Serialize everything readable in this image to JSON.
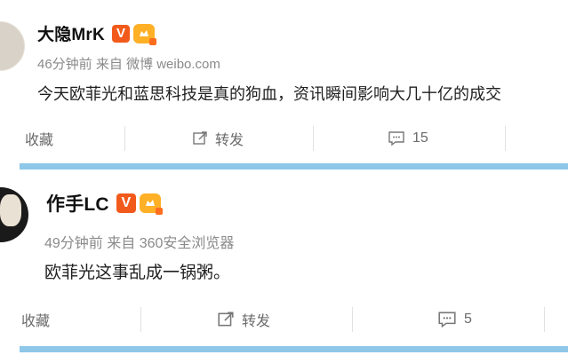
{
  "posts": [
    {
      "username": "大隐MrK",
      "badge": "V",
      "meta": "46分钟前 来自 微博 weibo.com",
      "content": "今天欧菲光和蓝思科技是真的狗血，资讯瞬间影响大几十亿的成交",
      "actions": {
        "favorite": "收藏",
        "repost": "转发",
        "comment": "15"
      }
    },
    {
      "username": "作手LC",
      "badge": "V",
      "meta": "49分钟前 来自 360安全浏览器",
      "content": "欧菲光这事乱成一锅粥。",
      "actions": {
        "favorite": "收藏",
        "repost": "转发",
        "comment": "5"
      }
    }
  ],
  "colors": {
    "badge": "#f25a1b",
    "level": "#ffb027",
    "separator": "#8ec7e8",
    "meta": "#8a8a8a"
  },
  "icons": [
    "level-icon",
    "repost-icon",
    "comment-icon"
  ]
}
